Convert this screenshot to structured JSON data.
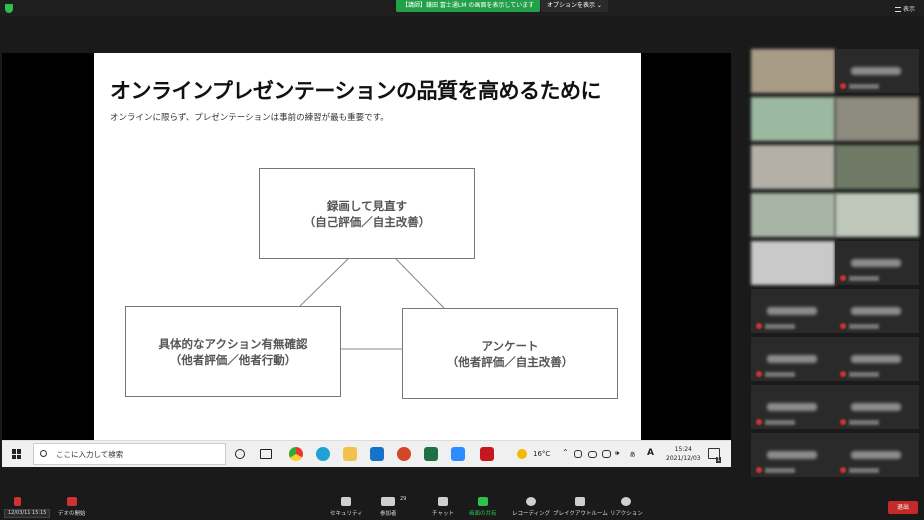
{
  "topbar": {
    "share_banner": "【講師】鎌田 富士通LM の画面を表示しています",
    "options_label": "オプションを表示",
    "view_label": "表示"
  },
  "slide": {
    "title": "オンラインプレゼンテーションの品質を高めるために",
    "subtitle": "オンラインに限らず、プレゼンテーションは事前の練習が最も重要です。",
    "boxes": [
      {
        "line1": "録画して見直す",
        "line2": "（自己評価／自主改善）"
      },
      {
        "line1": "具体的なアクション有無確認",
        "line2": "（他者評価／他者行動）"
      },
      {
        "line1": "アンケート",
        "line2": "（他者評価／自主改善）"
      }
    ]
  },
  "taskbar": {
    "search_placeholder": "ここに入力して検索",
    "weather": "16°C",
    "time": "15:24",
    "date": "2021/12/03",
    "notifications": "1",
    "ime": "A"
  },
  "controls": {
    "mute_caption": "12/03/11 15:15",
    "video_label": "デオの開始",
    "security": "セキュリティ",
    "participants": "参加者",
    "participants_count": "29",
    "chat": "チャット",
    "share": "画面の共有",
    "record": "レコーディング",
    "breakout": "ブレイクアウトルーム",
    "reaction": "リアクション",
    "leave": "退出"
  },
  "colors": {
    "zoom_green": "#2fbf4a",
    "leave_red": "#c52a2a"
  }
}
